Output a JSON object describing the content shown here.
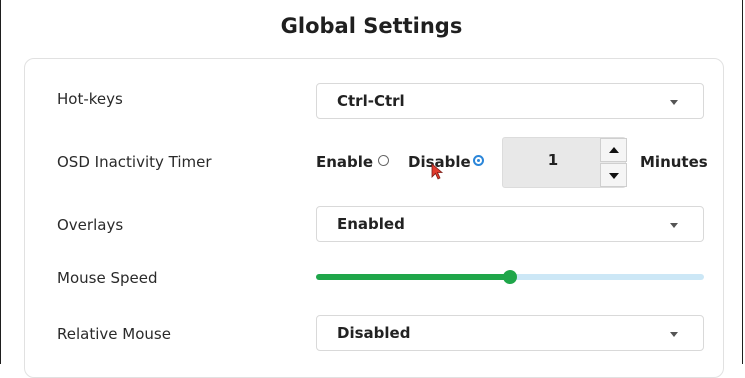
{
  "title": "Global Settings",
  "hotkeys": {
    "label": "Hot-keys",
    "value": "Ctrl-Ctrl"
  },
  "osd_timer": {
    "label": "OSD Inactivity Timer",
    "enable_label": "Enable",
    "disable_label": "Disable",
    "selected": "disable",
    "value": "1",
    "unit": "Minutes"
  },
  "overlays": {
    "label": "Overlays",
    "value": "Enabled"
  },
  "mouse_speed": {
    "label": "Mouse Speed",
    "level": 0.5
  },
  "relative_mouse": {
    "label": "Relative Mouse",
    "value": "Disabled"
  },
  "colors": {
    "accent": "#1fa64a",
    "track": "#cce7f6",
    "radio": "#2b86d9"
  },
  "icons": [
    "chevron-down-icon",
    "radio-icon",
    "stepper-up-icon",
    "stepper-down-icon",
    "mouse-cursor-icon"
  ]
}
